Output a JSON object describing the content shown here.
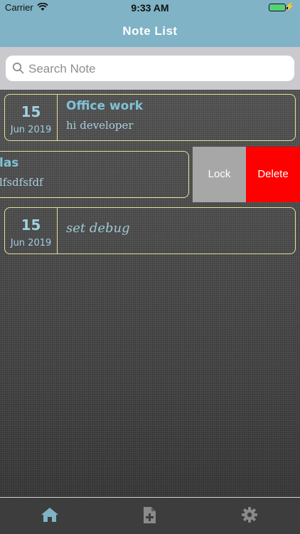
{
  "status": {
    "carrier": "Carrier",
    "time": "9:33 AM"
  },
  "nav": {
    "title": "Note List"
  },
  "search": {
    "placeholder": "Search Note"
  },
  "notes": [
    {
      "day": "15",
      "month": "Jun 2019",
      "title": "Office work",
      "description": "hi developer"
    },
    {
      "title": "las",
      "description": "lfsdfsfdf"
    },
    {
      "day": "15",
      "month": "Jun 2019",
      "title": "",
      "description": "set debug"
    }
  ],
  "swipe_actions": {
    "lock_label": "Lock",
    "delete_label": "Delete"
  },
  "tabs": [
    {
      "icon": "home-icon",
      "active": true
    },
    {
      "icon": "add-note-icon",
      "active": false
    },
    {
      "icon": "gear-icon",
      "active": false
    }
  ],
  "colors": {
    "nav": "#7fb3c5",
    "card_border": "#e6e09a",
    "accent": "#7fc3d6",
    "lock": "#a7a7a7",
    "delete": "#fe0000"
  }
}
